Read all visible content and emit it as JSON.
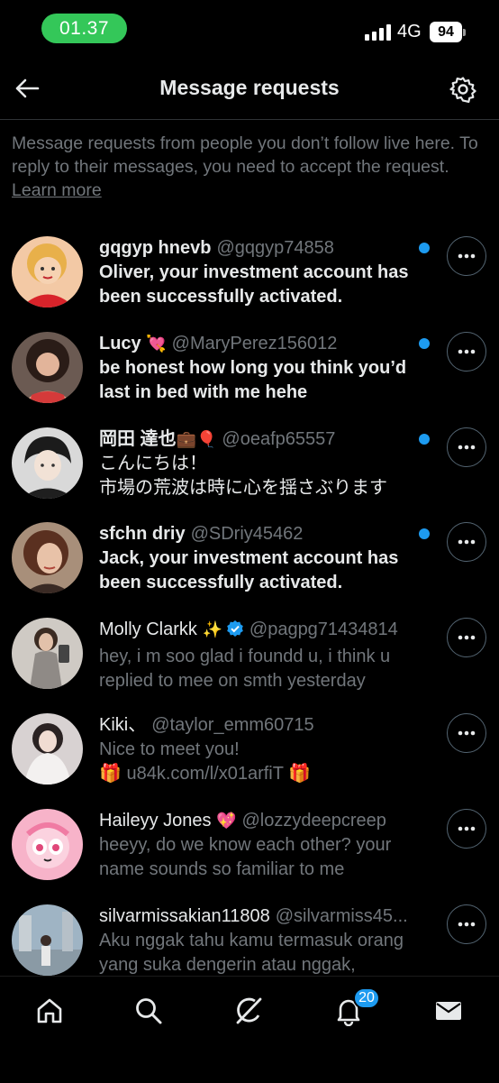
{
  "status_bar": {
    "time": "01.37",
    "network": "4G",
    "battery": "94"
  },
  "header": {
    "title": "Message requests"
  },
  "info": {
    "text": "Message requests from people you don’t follow live here. To reply to their messages, you need to accept the request.",
    "link": "Learn more"
  },
  "requests": [
    {
      "name": "gqgyp hnevb",
      "emoji": "",
      "handle": "@gqgyp74858",
      "message": "Oliver, your investment account has been successfully activated.",
      "unread": true
    },
    {
      "name": "Lucy",
      "emoji": "💘",
      "handle": "@MaryPerez156012",
      "message": "be honest how long you think you’d last in bed with me hehe",
      "unread": true
    },
    {
      "name": "岡田 達也",
      "emoji": "💼🎈",
      "handle": "@oeafp65557",
      "message": "こんにちは！\n市場の荒波は時に心を揺さぶります",
      "unread": true
    },
    {
      "name": "sfchn driy",
      "emoji": "",
      "handle": "@SDriy45462",
      "message": "Jack, your investment account has been successfully activated.",
      "unread": true
    },
    {
      "name": "Molly Clarkk",
      "emoji": "✨",
      "handle": "@pagpg71434814",
      "message": "hey, i m soo glad i foundd u, i think u replied to mee on smth yesterday",
      "unread": false,
      "verified": true
    },
    {
      "name": "Kiki、",
      "emoji": "",
      "handle": "@taylor_emm60715",
      "message": "Nice to meet you!\n🎁 u84k.com/l/x01arfiT 🎁",
      "unread": false
    },
    {
      "name": "Haileyy Jones",
      "emoji": "💖",
      "handle": "@lozzydeepcreep",
      "message": "heeyy, do we know each other? your name sounds so familiar to me",
      "unread": false
    },
    {
      "name": "silvarmissakian11808",
      "emoji": "",
      "handle": "@silvarmiss45...",
      "message": "Aku nggak tahu kamu termasuk orang yang suka dengerin atau nggak,",
      "unread": false
    }
  ],
  "tabbar": {
    "notifications_badge": "20"
  },
  "colors": {
    "accent": "#1d9bf0",
    "background": "#000000",
    "secondary_text": "#71767b",
    "status_green": "#34c759"
  },
  "icons": [
    "back-arrow-icon",
    "gear-icon",
    "more-dots-icon",
    "verified-badge-icon",
    "home-icon",
    "search-icon",
    "grok-icon",
    "bell-icon",
    "mail-icon"
  ]
}
